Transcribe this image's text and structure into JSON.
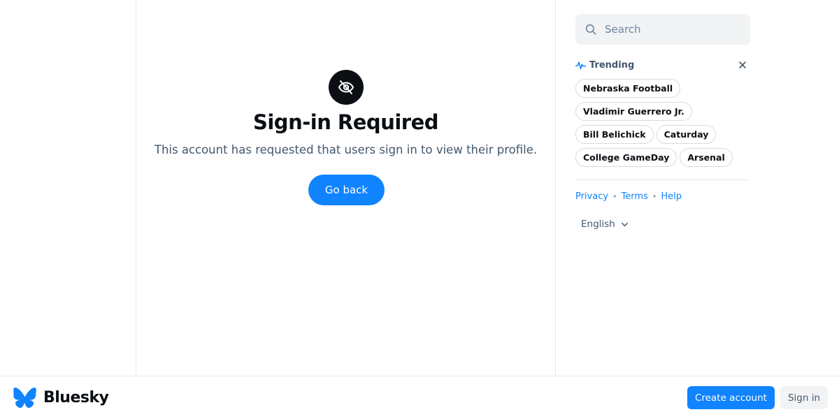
{
  "main": {
    "icon": "eye-slash-icon",
    "title": "Sign-in Required",
    "subtitle": "This account has requested that users sign in to view their profile.",
    "go_back_label": "Go back"
  },
  "sidebar": {
    "search": {
      "placeholder": "Search",
      "value": ""
    },
    "trending": {
      "label": "Trending",
      "items": [
        "Nebraska Football",
        "Vladimir Guerrero Jr.",
        "Bill Belichick",
        "Caturday",
        "College GameDay",
        "Arsenal"
      ]
    },
    "footer_links": [
      "Privacy",
      "Terms",
      "Help"
    ],
    "language": "English"
  },
  "bottom_bar": {
    "logo_text": "Bluesky",
    "create_account_label": "Create account",
    "sign_in_label": "Sign in"
  },
  "colors": {
    "accent": "#1083fe",
    "text_primary": "#0b0f14",
    "text_secondary": "#42576c",
    "border": "#e3e7ec"
  }
}
